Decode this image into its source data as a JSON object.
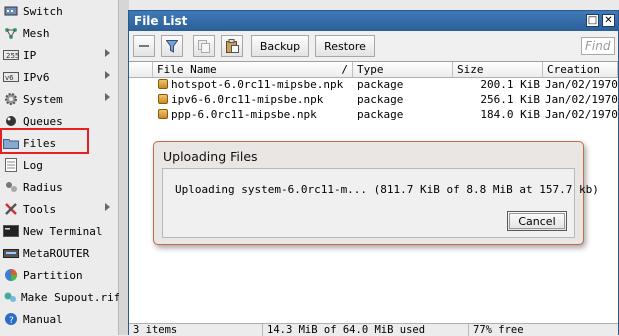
{
  "sidebar": {
    "items": [
      {
        "label": "Switch",
        "icon": "switch-icon",
        "arrow": false
      },
      {
        "label": "Mesh",
        "icon": "mesh-icon",
        "arrow": false
      },
      {
        "label": "IP",
        "icon": "ip-icon",
        "arrow": true
      },
      {
        "label": "IPv6",
        "icon": "ipv6-icon",
        "arrow": true
      },
      {
        "label": "System",
        "icon": "gear-icon",
        "arrow": true
      },
      {
        "label": "Queues",
        "icon": "queues-icon",
        "arrow": false
      },
      {
        "label": "Files",
        "icon": "folder-icon",
        "arrow": false
      },
      {
        "label": "Log",
        "icon": "log-icon",
        "arrow": false
      },
      {
        "label": "Radius",
        "icon": "radius-icon",
        "arrow": false
      },
      {
        "label": "Tools",
        "icon": "tools-icon",
        "arrow": true
      },
      {
        "label": "New Terminal",
        "icon": "terminal-icon",
        "arrow": false
      },
      {
        "label": "MetaROUTER",
        "icon": "metarouter-icon",
        "arrow": false
      },
      {
        "label": "Partition",
        "icon": "partition-icon",
        "arrow": false
      },
      {
        "label": "Make Supout.rif",
        "icon": "supout-icon",
        "arrow": false
      },
      {
        "label": "Manual",
        "icon": "manual-icon",
        "arrow": false
      }
    ]
  },
  "window": {
    "title": "File List",
    "restore_glyph": "□",
    "close_glyph": "✕"
  },
  "toolbar": {
    "backup_label": "Backup",
    "restore_label": "Restore",
    "find_placeholder": "Find"
  },
  "table": {
    "columns": [
      "File Name",
      "Type",
      "Size",
      "Creation"
    ],
    "rows": [
      {
        "name": "hotspot-6.0rc11-mipsbe.npk",
        "type": "package",
        "size": "200.1 KiB",
        "creation": "Jan/02/1970"
      },
      {
        "name": "ipv6-6.0rc11-mipsbe.npk",
        "type": "package",
        "size": "256.1 KiB",
        "creation": "Jan/02/1970"
      },
      {
        "name": "ppp-6.0rc11-mipsbe.npk",
        "type": "package",
        "size": "184.0 KiB",
        "creation": "Jan/02/1970"
      }
    ]
  },
  "status": {
    "items_count": "3 items",
    "used": "14.3 MiB of 64.0 MiB used",
    "free": "77% free"
  },
  "dialog": {
    "title": "Uploading Files",
    "message": "Uploading system-6.0rc11-m...  (811.7 KiB of 8.8 MiB at 157.7 kb)",
    "cancel_label": "Cancel"
  },
  "colors": {
    "titlebar": "#2c5f98",
    "highlight": "#e52020",
    "dialog_border": "#c26c4a"
  }
}
